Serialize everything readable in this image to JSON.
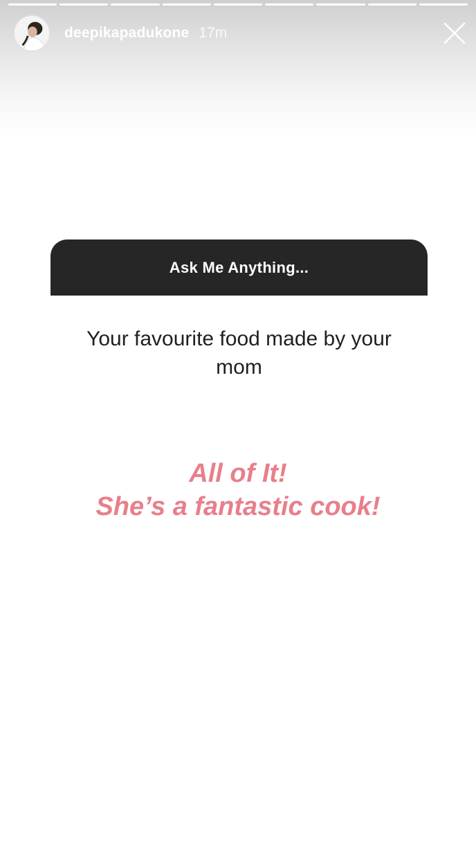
{
  "story": {
    "segments": 9,
    "username": "deepikapadukone",
    "time": "17m",
    "close_icon": "close-icon"
  },
  "question_sticker": {
    "header": "Ask Me Anything...",
    "question": "Your favourite food made by your mom"
  },
  "answer": {
    "line1": "All of It!",
    "line2": "She’s a fantastic cook!",
    "color": "#e87f8b"
  },
  "colors": {
    "sticker_header_bg": "#262626",
    "background": "#ffffff"
  }
}
